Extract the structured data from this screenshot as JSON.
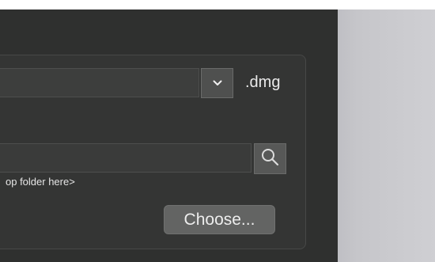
{
  "format": {
    "extension_label": ".dmg",
    "dropdown_icon": "chevron-down-icon"
  },
  "destination": {
    "search_icon": "search-icon",
    "hint_text": "op folder here>"
  },
  "actions": {
    "choose_label": "Choose..."
  },
  "colors": {
    "window_bg": "#2f302f",
    "panel_bg": "#343534",
    "button_bg": "#636463",
    "backdrop": "#cfcfd3"
  }
}
